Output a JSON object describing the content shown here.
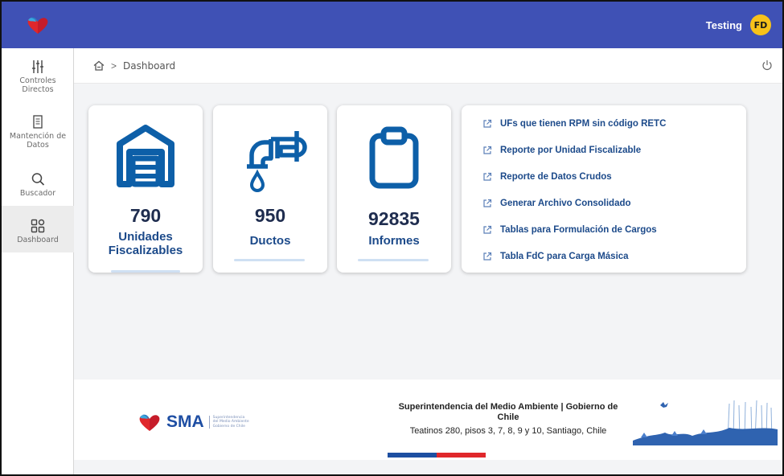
{
  "header": {
    "user_name": "Testing",
    "avatar_initials": "FD",
    "bar_color": "#3f51b5",
    "avatar_color": "#f7c21a"
  },
  "sidebar": {
    "items": [
      {
        "label": "Controles Directos",
        "icon": "sliders-icon",
        "active": false
      },
      {
        "label": "Mantención de Datos",
        "icon": "document-icon",
        "active": false
      },
      {
        "label": "Buscador",
        "icon": "search-icon",
        "active": false
      },
      {
        "label": "Dashboard",
        "icon": "dashboard-icon",
        "active": true
      }
    ]
  },
  "breadcrumb": {
    "home_icon": "home-icon",
    "separator": ">",
    "current": "Dashboard",
    "power_icon": "power-icon"
  },
  "stats": [
    {
      "value": "790",
      "label_line1": "Unidades",
      "label_line2": "Fiscalizables",
      "icon": "warehouse-icon"
    },
    {
      "value": "950",
      "label_line1": "Ductos",
      "label_line2": "",
      "icon": "pipe-icon"
    },
    {
      "value": "92835",
      "label_line1": "Informes",
      "label_line2": "",
      "icon": "clipboard-icon"
    }
  ],
  "reports": {
    "link_icon": "external-link-icon",
    "items": [
      "UFs que tienen RPM sin código RETC",
      "Reporte por Unidad Fiscalizable",
      "Reporte de Datos Crudos",
      "Generar Archivo Consolidado",
      "Tablas para Formulación de Cargos",
      "Tabla FdC para Carga Másica"
    ]
  },
  "footer": {
    "brand": "SMA",
    "brand_sub": "Superintendencia del Medio Ambiente Gobierno de Chile",
    "org_line": "Superintendencia del Medio Ambiente | Gobierno de Chile",
    "address": "Teatinos 280, pisos 3, 7, 8, 9 y 10, Santiago, Chile",
    "flag_colors": [
      "#1d4fa1",
      "#e0272b"
    ],
    "accent_color": "#1c4a8a"
  }
}
